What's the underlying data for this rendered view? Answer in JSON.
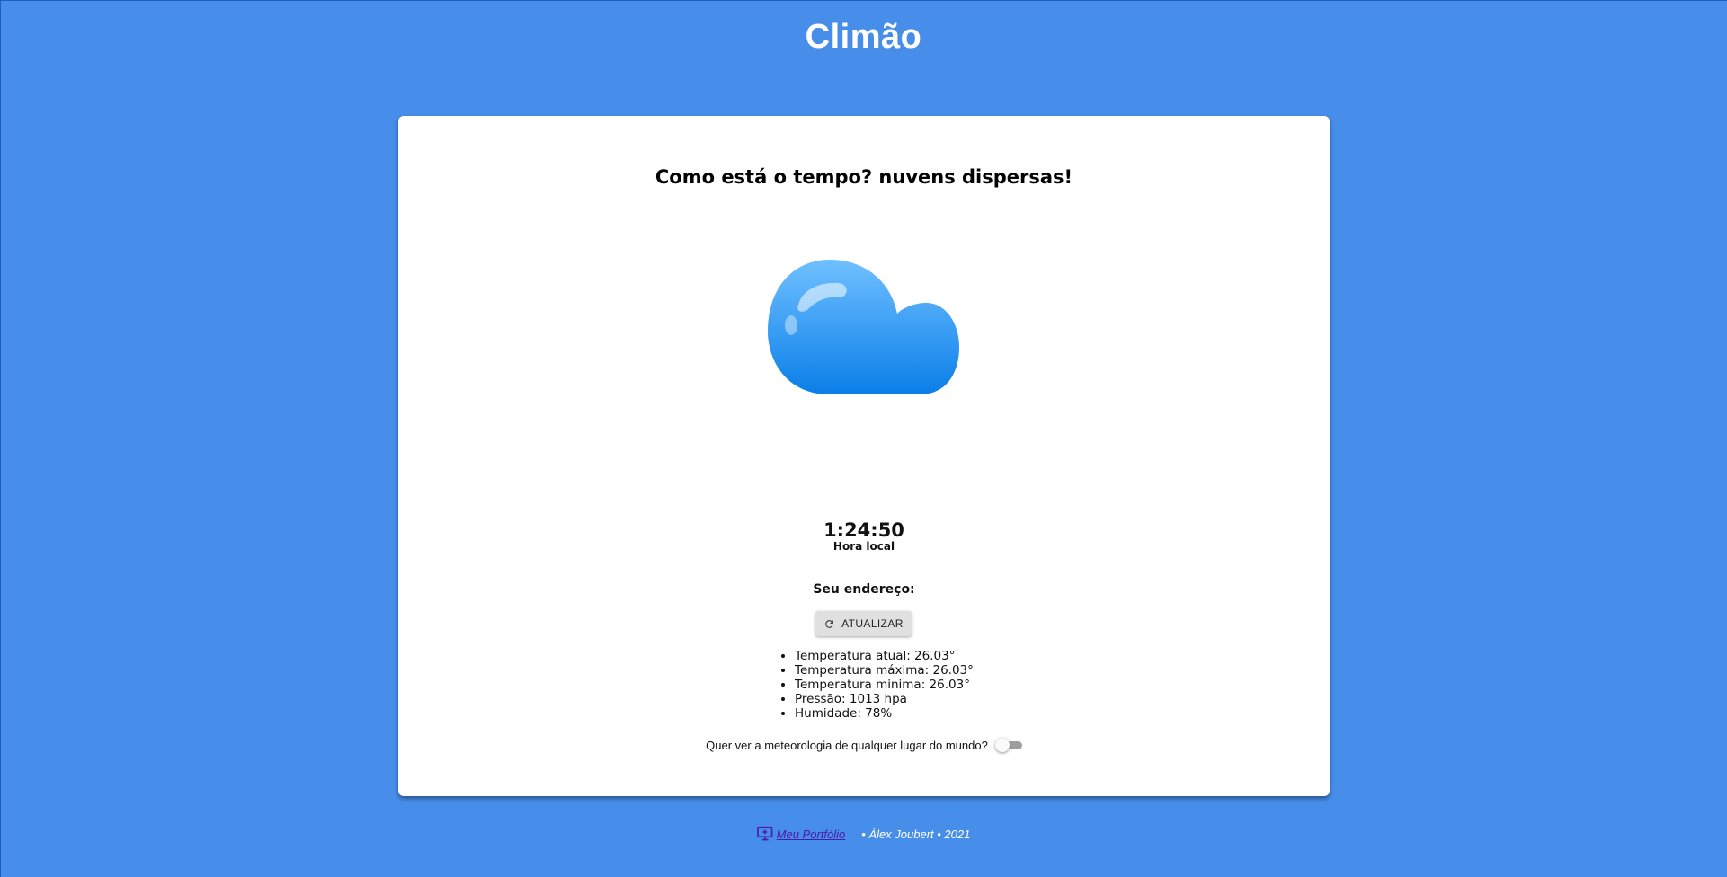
{
  "app": {
    "title": "Climão"
  },
  "weather": {
    "heading": "Como está o tempo? nuvens dispersas!",
    "icon": "cloud-icon"
  },
  "clock": {
    "time": "1:24:50",
    "label": "Hora local"
  },
  "address": {
    "label": "Seu endereço:"
  },
  "refresh_button": {
    "label": "ATUALIZAR",
    "icon": "refresh-icon"
  },
  "stats": [
    "Temperatura atual: 26.03°",
    "Temperatura máxima: 26.03°",
    "Temperatura minima: 26.03°",
    "Pressão: 1013 hpa",
    "Humidade: 78%"
  ],
  "world_toggle": {
    "label": "Quer ver a meteorologia de qualquer lugar do mundo?",
    "checked": false
  },
  "footer": {
    "portfolio_label": "Meu Portfólio",
    "portfolio_icon": "portfolio-icon",
    "credit": "• Álex Joubert • 2021"
  },
  "colors": {
    "background": "#478eea",
    "card": "#ffffff",
    "cloud_top": "#6fc0ff",
    "cloud_bottom": "#0a7ee8",
    "link": "#4a1aa8"
  }
}
